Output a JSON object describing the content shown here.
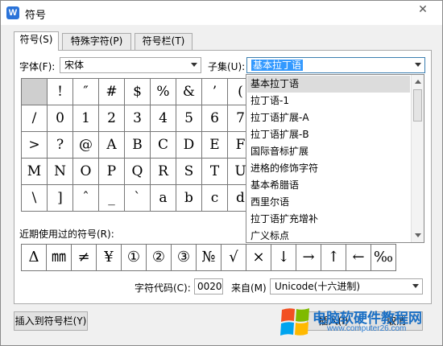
{
  "window": {
    "title": "符号",
    "app_icon": "W",
    "close": "✕"
  },
  "tabs": [
    {
      "label": "符号(S)"
    },
    {
      "label": "特殊字符(P)"
    },
    {
      "label": "符号栏(T)"
    }
  ],
  "font": {
    "label": "字体(F):",
    "value": "宋体"
  },
  "subset": {
    "label": "子集(U):",
    "value": "基本拉丁语"
  },
  "subset_options": [
    "基本拉丁语",
    "拉丁语-1",
    "拉丁语扩展-A",
    "拉丁语扩展-B",
    "国际音标扩展",
    "进格的修饰字符",
    "基本希腊语",
    "西里尔语",
    "拉丁语扩充增补",
    "广义标点"
  ],
  "symbols": [
    [
      "",
      "!",
      "″",
      "#",
      "$",
      "%",
      "&",
      "’",
      "("
    ],
    [
      "/",
      "0",
      "1",
      "2",
      "3",
      "4",
      "5",
      "6",
      "7"
    ],
    [
      ">",
      "?",
      "@",
      "A",
      "B",
      "C",
      "D",
      "E",
      "F"
    ],
    [
      "M",
      "N",
      "O",
      "P",
      "Q",
      "R",
      "S",
      "T",
      "U"
    ],
    [
      "\\",
      "]",
      "ˆ",
      "_",
      "ˋ",
      "a",
      "b",
      "c",
      "d"
    ]
  ],
  "recent_label": "近期使用过的符号(R):",
  "recent": [
    "Δ",
    "㎜",
    "≠",
    "¥",
    "①",
    "②",
    "③",
    "№",
    "√",
    "×",
    "↓",
    "→",
    "↑",
    "←",
    "‰"
  ],
  "char_code": {
    "label": "字符代码(C):",
    "value": "0020",
    "from_label": "来自(M)",
    "from_value": "Unicode(十六进制)"
  },
  "buttons": {
    "insert_to_bar": "插入到符号栏(Y)",
    "insert": "插入(I)",
    "cancel": "取消"
  },
  "watermark": {
    "title": "电脑软硬件教程网",
    "url": "www.computer26.com"
  },
  "colors": {
    "accent": "#3399ff",
    "watermark_text": "#1a6fc4"
  }
}
